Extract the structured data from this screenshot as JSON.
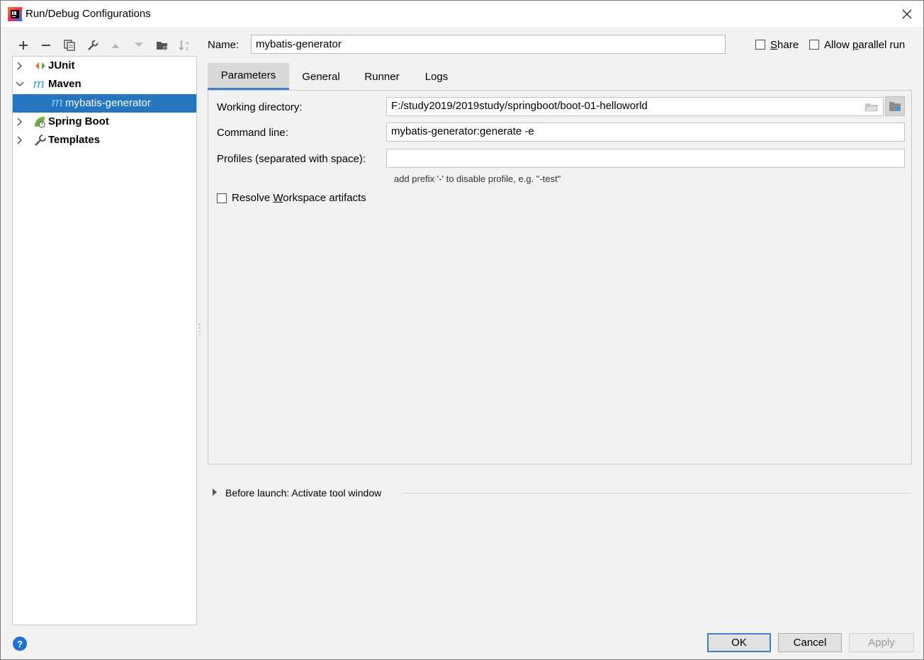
{
  "window": {
    "title": "Run/Debug Configurations"
  },
  "toolbar": {
    "items": [
      "add",
      "remove",
      "copy",
      "edit-defaults",
      "move-up",
      "move-down",
      "new-folder",
      "sort"
    ]
  },
  "tree": {
    "nodes": [
      {
        "label": "JUnit",
        "icon": "junit-icon",
        "expanded": false
      },
      {
        "label": "Maven",
        "icon": "maven-icon",
        "expanded": true
      },
      {
        "label": "mybatis-generator",
        "icon": "maven-config-icon",
        "selected": true
      },
      {
        "label": "Spring Boot",
        "icon": "spring-boot-icon",
        "expanded": false
      },
      {
        "label": "Templates",
        "icon": "wrench-icon",
        "expanded": false
      }
    ]
  },
  "form": {
    "name_label": "Name:",
    "name_value": "mybatis-generator",
    "share_label_u": "S",
    "share_label_rest": "hare",
    "share_checked": false,
    "parallel_label_pre": "Allow ",
    "parallel_label_u": "p",
    "parallel_label_rest": "arallel run",
    "parallel_checked": false
  },
  "tabs": [
    {
      "label": "Parameters",
      "active": true
    },
    {
      "label": "General",
      "active": false
    },
    {
      "label": "Runner",
      "active": false
    },
    {
      "label": "Logs",
      "active": false
    }
  ],
  "parameters": {
    "working_dir_label": "Working directory:",
    "working_dir_value": "F:/study2019/2019study/springboot/boot-01-helloworld",
    "command_line_label": "Command line:",
    "command_line_value": "mybatis-generator:generate -e",
    "profiles_label": "Profiles (separated with space):",
    "profiles_value": "",
    "profiles_hint": "add prefix '-' to disable profile, e.g. \"-test\"",
    "resolve_label_pre": "Resolve ",
    "resolve_label_u": "W",
    "resolve_label_rest": "orkspace artifacts",
    "resolve_checked": false
  },
  "before_launch": {
    "label": "Before launch: Activate tool window"
  },
  "buttons": {
    "help": "?",
    "ok": "OK",
    "cancel": "Cancel",
    "apply": "Apply"
  },
  "colors": {
    "selection": "#2675bf",
    "accent": "#3e83c9",
    "maven": "#3aa9d8",
    "spring": "#6db33f"
  }
}
